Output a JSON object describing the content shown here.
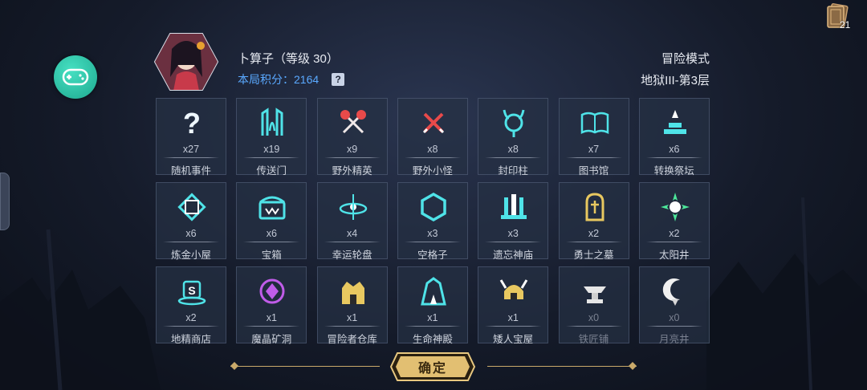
{
  "player": {
    "name_level": "卜算子（等级 30）",
    "score_label": "本局积分：2164",
    "help": "?"
  },
  "mode": {
    "label": "冒险模式",
    "floor": "地狱III-第3层"
  },
  "top_right": {
    "count": "21"
  },
  "colors": {
    "accent": "#4fe3e8",
    "gold": "#e8c860",
    "purple": "#c05ce8",
    "score": "#5aa9ff"
  },
  "grid": [
    {
      "count": "x27",
      "name": "随机事件",
      "icon": "question-icon"
    },
    {
      "count": "x19",
      "name": "传送门",
      "icon": "portal-icon"
    },
    {
      "count": "x9",
      "name": "野外精英",
      "icon": "crossed-axes-icon"
    },
    {
      "count": "x8",
      "name": "野外小怪",
      "icon": "crossed-swords-icon"
    },
    {
      "count": "x8",
      "name": "封印柱",
      "icon": "seal-pillar-icon"
    },
    {
      "count": "x7",
      "name": "图书馆",
      "icon": "book-icon"
    },
    {
      "count": "x6",
      "name": "转换祭坛",
      "icon": "altar-icon"
    },
    {
      "count": "x6",
      "name": "炼金小屋",
      "icon": "alchemy-icon"
    },
    {
      "count": "x6",
      "name": "宝箱",
      "icon": "chest-icon"
    },
    {
      "count": "x4",
      "name": "幸运轮盘",
      "icon": "wheel-icon"
    },
    {
      "count": "x3",
      "name": "空格子",
      "icon": "hexagon-icon"
    },
    {
      "count": "x3",
      "name": "遗忘神庙",
      "icon": "temple-icon"
    },
    {
      "count": "x2",
      "name": "勇士之墓",
      "icon": "tomb-icon"
    },
    {
      "count": "x2",
      "name": "太阳井",
      "icon": "sun-icon"
    },
    {
      "count": "x2",
      "name": "地精商店",
      "icon": "goblin-shop-icon"
    },
    {
      "count": "x1",
      "name": "魔晶矿洞",
      "icon": "crystal-mine-icon"
    },
    {
      "count": "x1",
      "name": "冒险者仓库",
      "icon": "warehouse-icon"
    },
    {
      "count": "x1",
      "name": "生命神殿",
      "icon": "life-shrine-icon"
    },
    {
      "count": "x1",
      "name": "矮人宝屋",
      "icon": "dwarf-helmet-icon"
    },
    {
      "count": "x0",
      "name": "铁匠铺",
      "icon": "anvil-icon"
    },
    {
      "count": "x0",
      "name": "月亮井",
      "icon": "moon-icon"
    }
  ],
  "confirm": {
    "label": "确定"
  }
}
